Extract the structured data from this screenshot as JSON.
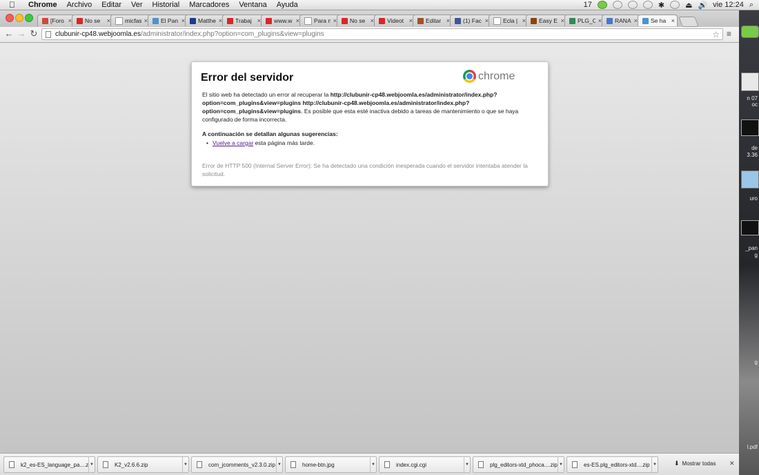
{
  "menubar": {
    "app": "Chrome",
    "items": [
      "Archivo",
      "Editar",
      "Ver",
      "Historial",
      "Marcadores",
      "Ventana",
      "Ayuda"
    ],
    "status_count": "17",
    "clock": "vie 12:24"
  },
  "tabs": [
    {
      "title": "[Foro J",
      "icon": "gmail-icon",
      "color": "#d44638"
    },
    {
      "title": "No se",
      "icon": "unir-icon",
      "color": "#d9262a"
    },
    {
      "title": "micfas",
      "icon": "page-icon",
      "color": "#ffffff"
    },
    {
      "title": "El Pan",
      "icon": "joomla-icon",
      "color": "#5091cd"
    },
    {
      "title": "Matthe",
      "icon": "facebook-page-icon",
      "color": "#1e3a8a"
    },
    {
      "title": "Trabaj",
      "icon": "unir-icon",
      "color": "#d9262a"
    },
    {
      "title": "www.w",
      "icon": "unir-icon",
      "color": "#d9262a"
    },
    {
      "title": "Para n",
      "icon": "page-icon",
      "color": "#ffffff"
    },
    {
      "title": "No se",
      "icon": "unir-icon",
      "color": "#d9262a"
    },
    {
      "title": "Videot",
      "icon": "unir-icon",
      "color": "#d9262a"
    },
    {
      "title": "Editar",
      "icon": "editor-icon",
      "color": "#a0522d"
    },
    {
      "title": "(1) Fac",
      "icon": "facebook-icon",
      "color": "#3b5998"
    },
    {
      "title": "Ecla |",
      "icon": "sigma-icon",
      "color": "#ffffff"
    },
    {
      "title": "Easy E",
      "icon": "extension-icon",
      "color": "#8b4513"
    },
    {
      "title": "PLG_C",
      "icon": "plugin-icon",
      "color": "#2e8b57"
    },
    {
      "title": "RANA",
      "icon": "google-plus-icon",
      "color": "#4a76c9"
    },
    {
      "title": "Se ha",
      "icon": "joomla-icon",
      "color": "#5091cd"
    }
  ],
  "omnibox": {
    "host": "clubunir-cp48.webjoomla.es",
    "path": "/administrator/index.php?option=com_plugins&view=plugins"
  },
  "error_page": {
    "title": "Error del servidor",
    "brand": "chrome",
    "body_intro": "El sitio web ha detectado un error al recuperar la ",
    "body_url": "http://clubunir-cp48.webjoomla.es/administrator/index.php?option=com_plugins&view=plugins http://clubunir-cp48.webjoomla.es/administrator/index.php?option=com_plugins&view=plugins",
    "body_outro": ". Es posible que esta esté inactiva debido a tareas de mantenimiento o que se haya configurado de forma incorrecta.",
    "suggestions_heading": "A continuación se detallan algunas sugerencias:",
    "reload_link": "Vuelve a cargar",
    "reload_rest": " esta página más tarde.",
    "http_detail": "Error de HTTP 500 (Internal Server Error): Se ha detectado una condición inesperada cuando el servidor intentaba atender la solicitud."
  },
  "downloads": [
    {
      "name": "k2_es-ES_language_pa....zip"
    },
    {
      "name": "K2_v2.6.6.zip"
    },
    {
      "name": "com_jcomments_v2.3.0.zip"
    },
    {
      "name": "home-btn.jpg"
    },
    {
      "name": "index.cgi.cgi"
    },
    {
      "name": "plg_editors-xtd_phoca....zip"
    },
    {
      "name": "es-ES.plg_editors-xtd....zip"
    }
  ],
  "download_shelf": {
    "show_all": "Mostrar todas"
  },
  "desktop_labels": [
    "n 07",
    "oc",
    "de",
    "3.36",
    "uro",
    "_pan",
    "g",
    "g",
    "l.pdf"
  ]
}
